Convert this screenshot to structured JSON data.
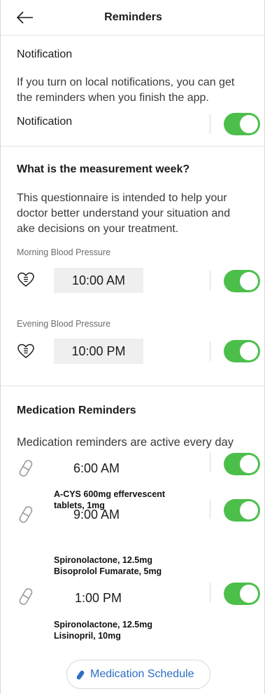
{
  "header": {
    "title": "Reminders"
  },
  "notification": {
    "section_title": "Notification",
    "description_line1": "If you turn on local notifications, you can get",
    "description_line2": "the reminders when you finish the app.",
    "toggle_label": "Notification",
    "enabled": true
  },
  "measurement": {
    "title": "What is the measurement week?",
    "description_line1": "This questionnaire is intended to help your",
    "description_line2": "doctor better understand your situation and",
    "description_line3": "ake decisions on your treatment.",
    "items": [
      {
        "label": "Morning Blood Pressure",
        "time": "10:00 AM",
        "enabled": true,
        "icon": "heart-icon"
      },
      {
        "label": "Evening Blood Pressure",
        "time": "10:00 PM",
        "enabled": true,
        "icon": "heart-icon"
      }
    ]
  },
  "medication": {
    "title": "Medication Reminders",
    "description": "Medication reminders are active every day",
    "items": [
      {
        "time": "6:00 AM",
        "line1": "A-CYS 600mg effervescent",
        "line2": "tablets, 1mg",
        "enabled": true,
        "icon": "pill-icon"
      },
      {
        "time": "9:00 AM",
        "line1": "Spironolactone, 12.5mg",
        "line2": "Bisoprolol Fumarate, 5mg",
        "enabled": true,
        "icon": "pill-icon"
      },
      {
        "time": "1:00 PM",
        "line1": "Spironolactone, 12.5mg",
        "line2": "Lisinopril, 10mg",
        "enabled": true,
        "icon": "pill-icon"
      }
    ],
    "schedule_button": "Medication Schedule"
  },
  "colors": {
    "toggle_on": "#4cbf4b",
    "link": "#2c6ec4",
    "timebox_bg": "#efefef"
  }
}
